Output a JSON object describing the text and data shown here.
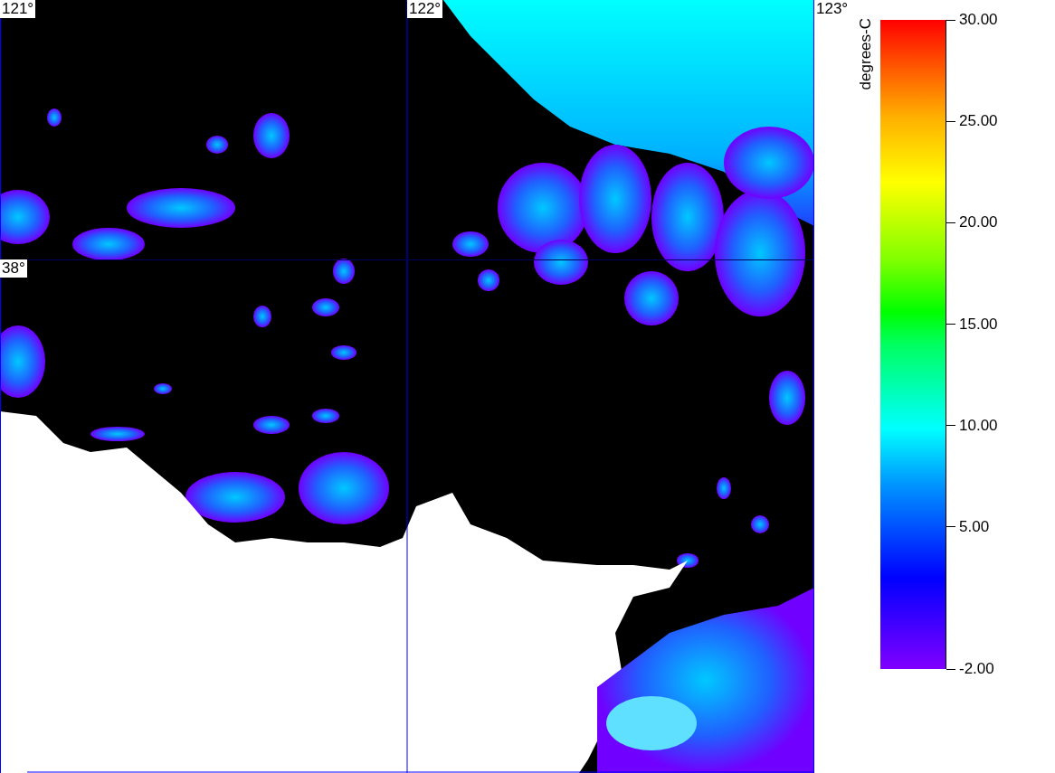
{
  "map": {
    "longitude_labels": [
      "121°",
      "122°",
      "123°"
    ],
    "latitude_labels": [
      "38°"
    ]
  },
  "colorbar": {
    "title": "degrees-C",
    "ticks": [
      "30.00",
      "25.00",
      "20.00",
      "15.00",
      "10.00",
      "5.00",
      "-2.00"
    ]
  }
}
